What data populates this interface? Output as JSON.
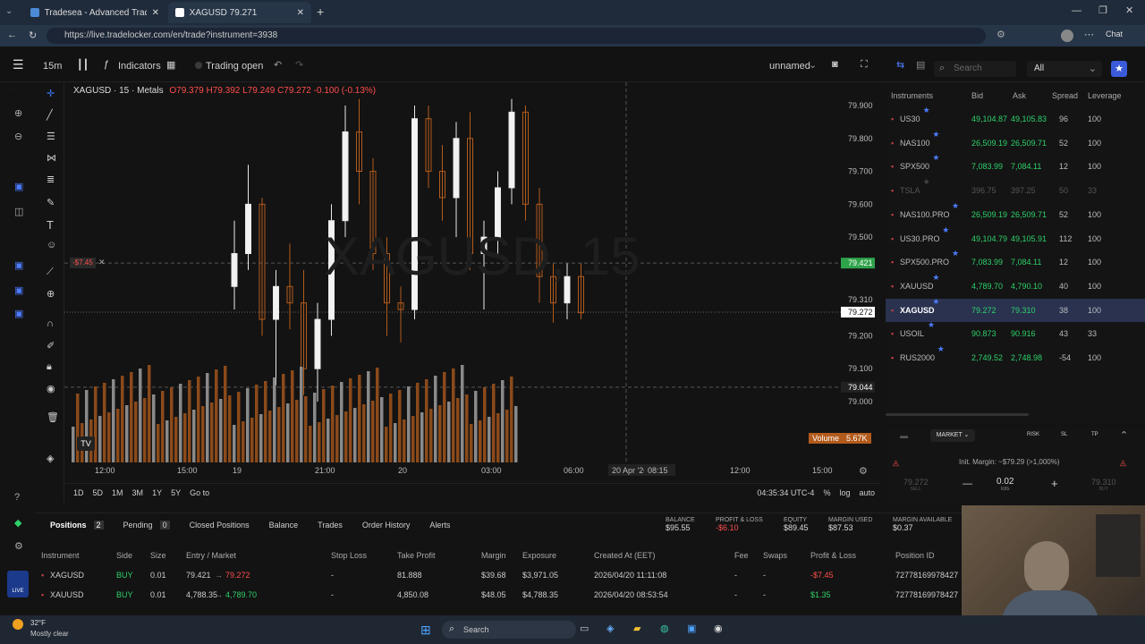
{
  "browser": {
    "tab1_title": "Tradesea - Advanced Trading Dash",
    "tab2_title": "XAGUSD 79.271",
    "url": "https://live.tradelocker.com/en/trade?instrument=3938"
  },
  "toolbar": {
    "timeframe": "15m",
    "indicators_label": "Indicators",
    "trading_status": "Trading open",
    "layout_name": "unnamed"
  },
  "chart": {
    "symbol_line": "XAGUSD · 15 · Metals",
    "ohlc": {
      "o": "O79.379",
      "h": "H79.392",
      "l": "L79.249",
      "c": "C79.272 -0.100 (-0.13%)"
    },
    "watermark": "XAGUSD, 15",
    "price_axis": [
      "79.900",
      "79.800",
      "79.700",
      "79.600",
      "79.500",
      "79.421",
      "79.310",
      "79.272",
      "79.200",
      "79.100",
      "79.044",
      "79.000"
    ],
    "time_axis": [
      "12:00",
      "15:00",
      "19",
      "21:00",
      "20",
      "03:00",
      "06:00",
      "20 Apr '26",
      "08:15",
      "12:00",
      "15:00"
    ],
    "position_label": "-$7.45",
    "volume_label": "Volume",
    "volume_value": "5.67K",
    "bottom_ranges": [
      "1D",
      "5D",
      "1M",
      "3M",
      "1Y",
      "5Y",
      "Go to"
    ],
    "clock": "04:35:34 UTC-4",
    "pct": "%",
    "log": "log",
    "auto": "auto"
  },
  "instruments": {
    "search_placeholder": "Search",
    "filter": "All",
    "headers": [
      "Instruments",
      "Bid",
      "Ask",
      "Spread",
      "Leverage"
    ],
    "rows": [
      {
        "name": "US30",
        "bid": "49,104.87",
        "ask": "49,105.83",
        "spread": "96",
        "lev": "100",
        "dim": false
      },
      {
        "name": "NAS100",
        "bid": "26,509.19",
        "ask": "26,509.71",
        "spread": "52",
        "lev": "100",
        "dim": false
      },
      {
        "name": "SPX500",
        "bid": "7,083.99",
        "ask": "7,084.11",
        "spread": "12",
        "lev": "100",
        "dim": false
      },
      {
        "name": "TSLA",
        "bid": "396.75",
        "ask": "397.25",
        "spread": "50",
        "lev": "33",
        "dim": true
      },
      {
        "name": "NAS100.PRO",
        "bid": "26,509.19",
        "ask": "26,509.71",
        "spread": "52",
        "lev": "100",
        "dim": false
      },
      {
        "name": "US30.PRO",
        "bid": "49,104.79",
        "ask": "49,105.91",
        "spread": "112",
        "lev": "100",
        "dim": false
      },
      {
        "name": "SPX500.PRO",
        "bid": "7,083.99",
        "ask": "7,084.11",
        "spread": "12",
        "lev": "100",
        "dim": false
      },
      {
        "name": "XAUUSD",
        "bid": "4,789.70",
        "ask": "4,790.10",
        "spread": "40",
        "lev": "100",
        "dim": false
      },
      {
        "name": "XAGUSD",
        "bid": "79.272",
        "ask": "79.310",
        "spread": "38",
        "lev": "100",
        "dim": false
      },
      {
        "name": "USOIL",
        "bid": "90.873",
        "ask": "90.916",
        "spread": "43",
        "lev": "33",
        "dim": false
      },
      {
        "name": "RUS2000",
        "bid": "2,749.52",
        "ask": "2,748.98",
        "spread": "-54",
        "lev": "100",
        "dim": false
      }
    ]
  },
  "order": {
    "market_label": "MARKET",
    "risk": "RISK",
    "sl": "SL",
    "tp": "TP",
    "margin": "Init. Margin: ~$79.29 (>1,000%)",
    "sell_price": "79.272",
    "sell_label": "SELL",
    "buy_price": "79.310",
    "buy_label": "BUY",
    "lots_value": "0.02",
    "lots_label": "lots"
  },
  "account": {
    "balance_label": "BALANCE",
    "balance": "$95.55",
    "pl_label": "PROFIT & LOSS",
    "pl": "-$6.10",
    "equity_label": "EQUITY",
    "equity": "$89.45",
    "margin_used_label": "MARGIN USED",
    "margin_used": "$87.53",
    "margin_avail_label": "MARGIN AVAILABLE",
    "margin_avail": "$0.37"
  },
  "tabs": {
    "positions": "Positions",
    "positions_count": "2",
    "pending": "Pending",
    "pending_count": "0",
    "closed": "Closed Positions",
    "balance": "Balance",
    "trades": "Trades",
    "order_history": "Order History",
    "alerts": "Alerts"
  },
  "positions": {
    "headers": [
      "Instrument",
      "Side",
      "Size",
      "Entry / Market",
      "Stop Loss",
      "Take Profit",
      "Margin",
      "Exposure",
      "Created At (EET)",
      "Fee",
      "Swaps",
      "Profit & Loss",
      "Position ID"
    ],
    "rows": [
      {
        "instrument": "XAGUSD",
        "side": "BUY",
        "size": "0.01",
        "entry": "79.421",
        "market": "79.272",
        "sl": "-",
        "tp": "81.888",
        "margin": "$39.68",
        "exposure": "$3,971.05",
        "created": "2026/04/20 11:11:08",
        "fee": "-",
        "swaps": "-",
        "pl": "-$7.45",
        "id": "72778169978427"
      },
      {
        "instrument": "XAUUSD",
        "side": "BUY",
        "size": "0.01",
        "entry": "4,788.35",
        "market": "4,789.70",
        "sl": "-",
        "tp": "4,850.08",
        "margin": "$48.05",
        "exposure": "$4,788.35",
        "created": "2026/04/20 08:53:54",
        "fee": "-",
        "swaps": "-",
        "pl": "$1.35",
        "id": "72778169978427"
      }
    ]
  },
  "taskbar": {
    "weather_temp": "32°F",
    "weather_desc": "Mostly clear",
    "search": "Search"
  },
  "colors": {
    "up": "#e8e8e8",
    "down": "#b35b1c",
    "accent": "#3b5bdb",
    "green": "#2fd16a",
    "red": "#ff4d4d"
  }
}
